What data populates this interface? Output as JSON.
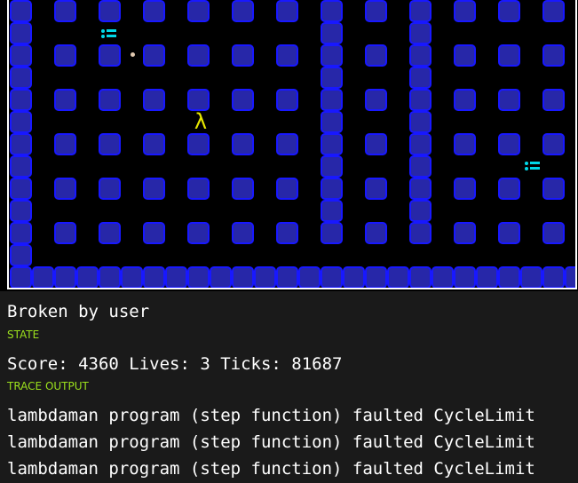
{
  "game": {
    "status_message": "Broken by user",
    "state_heading": "STATE",
    "state_line": "Score: 4360 Lives: 3 Ticks: 81687",
    "trace_heading": "TRACE OUTPUT",
    "trace_lines": [
      "lambdaman program (step function) faulted CycleLimit",
      "lambdaman program (step function) faulted CycleLimit",
      "lambdaman program (step function) faulted CycleLimit"
    ],
    "player_glyph": "λ"
  },
  "colors": {
    "wall_fill": "#2727a8",
    "wall_border": "#1818ff",
    "lambdaman": "#e8e800",
    "ghost": "#00d8e8",
    "pill": "#e0c8b0",
    "panel_bg": "#1a1a1a",
    "heading": "#9be01d"
  }
}
